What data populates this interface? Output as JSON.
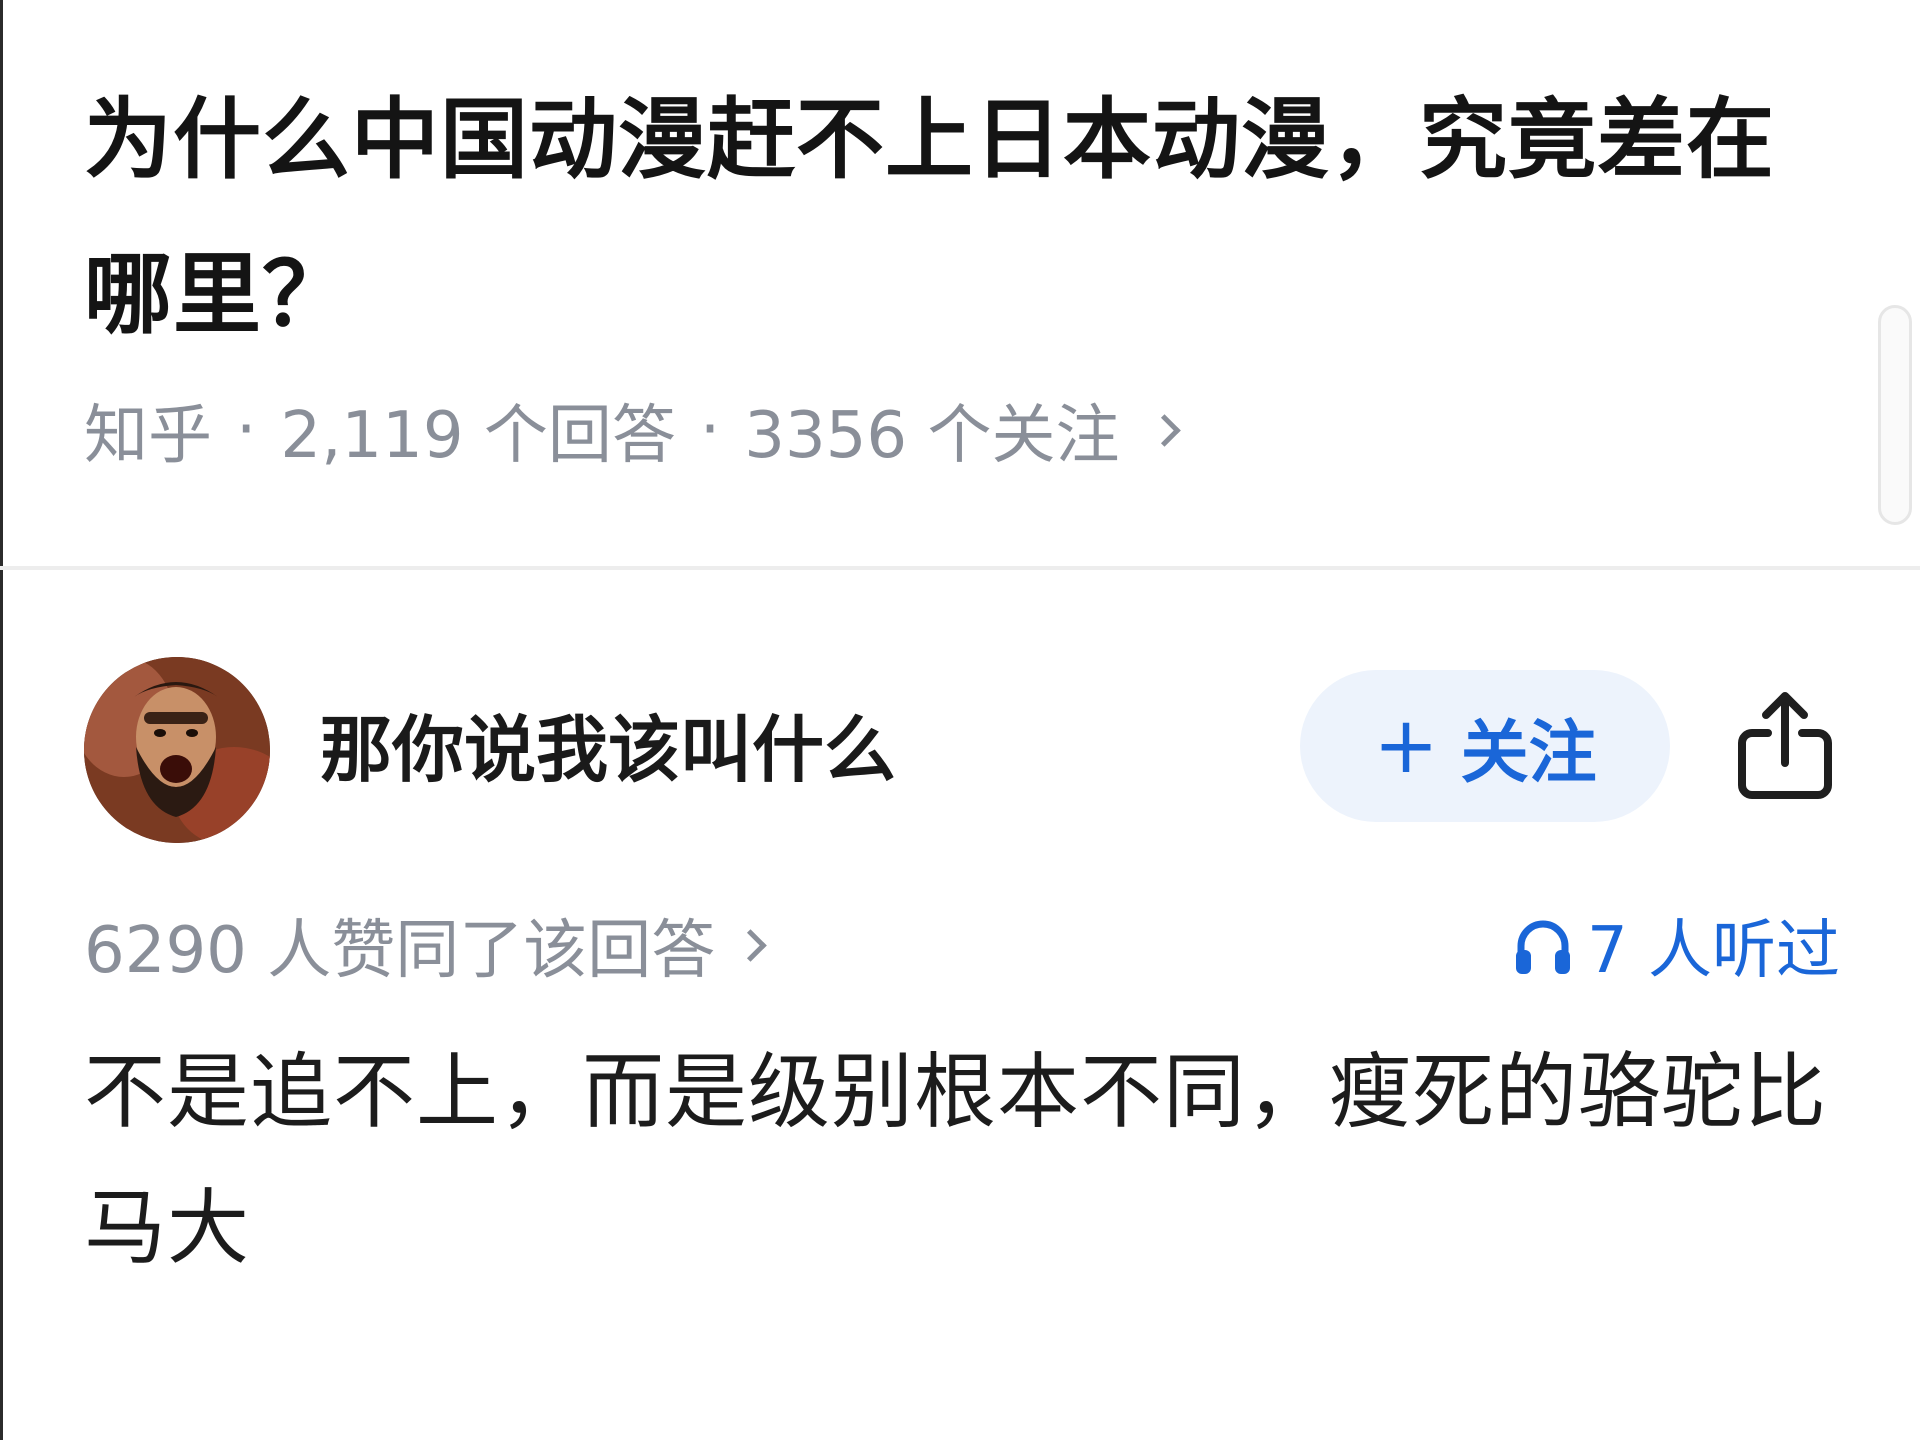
{
  "question": {
    "title": "为什么中国动漫赶不上日本动漫，究竟差在哪里？",
    "source": "知乎",
    "answers": "2,119 个回答",
    "followers": "3356 个关注"
  },
  "author": {
    "name": "那你说我该叫什么",
    "follow_label": "关注"
  },
  "answer": {
    "upvotes": "6290 人赞同了该回答",
    "listened": "7 人听过",
    "text": "不是追不上，而是级别根本不同，瘦死的骆驼比马大"
  },
  "icons": {
    "follow": "plus-icon",
    "share": "share-icon",
    "listened": "headphones-icon",
    "meta_chevron": "chevron-right-icon"
  },
  "colors": {
    "accent": "#1a66d8",
    "follow_bg": "#edf3fc",
    "meta_text": "#8a8f99",
    "title_text": "#141414"
  }
}
